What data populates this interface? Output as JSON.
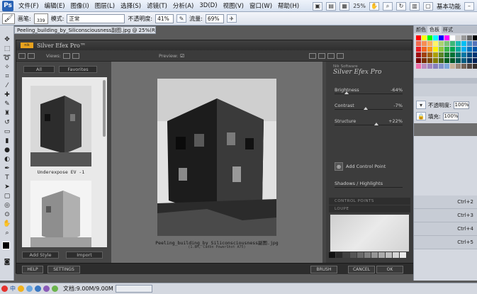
{
  "menubar": {
    "logo": "Ps",
    "items": [
      "文件(F)",
      "编辑(E)",
      "图像(I)",
      "图层(L)",
      "选择(S)",
      "滤镜(T)",
      "分析(A)",
      "3D(D)",
      "视图(V)",
      "窗口(W)",
      "帮助(H)"
    ],
    "zoom": "25%",
    "workspace": "基本功能"
  },
  "optbar": {
    "brush_label": "画笔:",
    "brush_size": "339",
    "mode_label": "模式:",
    "mode_value": "正常",
    "opacity_label": "不透明度:",
    "opacity_value": "41%",
    "flow_label": "流量:",
    "flow_value": "69%"
  },
  "doc_tab": "Peeling_building_by_Siliconsciousness副图.jpg @ 25%(RGB/8)",
  "rpanel": {
    "tabs": [
      "颜色",
      "色板",
      "样式"
    ],
    "opacity_label": "不透明度:",
    "opacity_value": "100%",
    "fill_label": "填充:",
    "fill_value": "100%",
    "shortcuts": [
      "Ctrl+2",
      "Ctrl+3",
      "Ctrl+4",
      "Ctrl+5"
    ],
    "swatch_colors": [
      "#ff0000",
      "#ffff00",
      "#00ff00",
      "#00ffff",
      "#0000ff",
      "#ff00ff",
      "#ffffff",
      "#cccccc",
      "#999999",
      "#666666",
      "#000000",
      "#f26c4f",
      "#f68e55",
      "#fbaf5c",
      "#fff467",
      "#acd372",
      "#7cc576",
      "#3bb878",
      "#1abbb4",
      "#00bff3",
      "#438cca",
      "#5574b9",
      "#ed1c24",
      "#f26522",
      "#f7941d",
      "#fff200",
      "#8dc73f",
      "#39b54a",
      "#00a651",
      "#00a99d",
      "#00aeef",
      "#0072bc",
      "#0054a6",
      "#9e0b0f",
      "#a0410d",
      "#a36209",
      "#aba000",
      "#598527",
      "#197b30",
      "#007236",
      "#00746b",
      "#0076a3",
      "#004b80",
      "#003471",
      "#790000",
      "#7b2e00",
      "#7d4900",
      "#827b00",
      "#406618",
      "#005e20",
      "#005826",
      "#005952",
      "#005b7f",
      "#003663",
      "#002157",
      "#f06eaa",
      "#bd8cbf",
      "#a186be",
      "#8781bd",
      "#8393ca",
      "#7da7d9",
      "#c7b299",
      "#998675",
      "#736357",
      "#534741",
      "#362f2d"
    ]
  },
  "silver_efex": {
    "title": "Silver Efex Pro™",
    "logo": "nik",
    "views_label": "Views:",
    "preview_label": "Preview:",
    "btn_all": "All",
    "btn_favorites": "Favorites",
    "thumb1_caption": "Underexpose EV -1",
    "btn_add_style": "Add Style",
    "btn_import": "Import",
    "photo_caption": "Peeling_building_by_Siliconsciousness副图.jpg",
    "photo_subcaption": "(1.8M, Canon PowerShot A75)",
    "panel_sub": "Nik Software",
    "panel_title": "Silver Efex Pro",
    "sliders": [
      {
        "label": "Brightness",
        "value": "-64%",
        "level": 0.18
      },
      {
        "label": "Contrast",
        "value": "-7%",
        "level": 0.46
      },
      {
        "label": "Structure",
        "value": "+22%",
        "level": 0.61
      }
    ],
    "add_control_point": "Add Control Point",
    "shadows_highlights": "Shadows / Highlights",
    "control_points_bar": "CONTROL POINTS",
    "loupe_bar": "LOUPE",
    "btn_help": "HELP",
    "btn_settings": "SETTINGS",
    "btn_brush": "BRUSH",
    "btn_cancel": "CANCEL",
    "btn_ok": "OK"
  },
  "statusbar": {
    "doc_info": "文档:9.00M/9.00M"
  }
}
